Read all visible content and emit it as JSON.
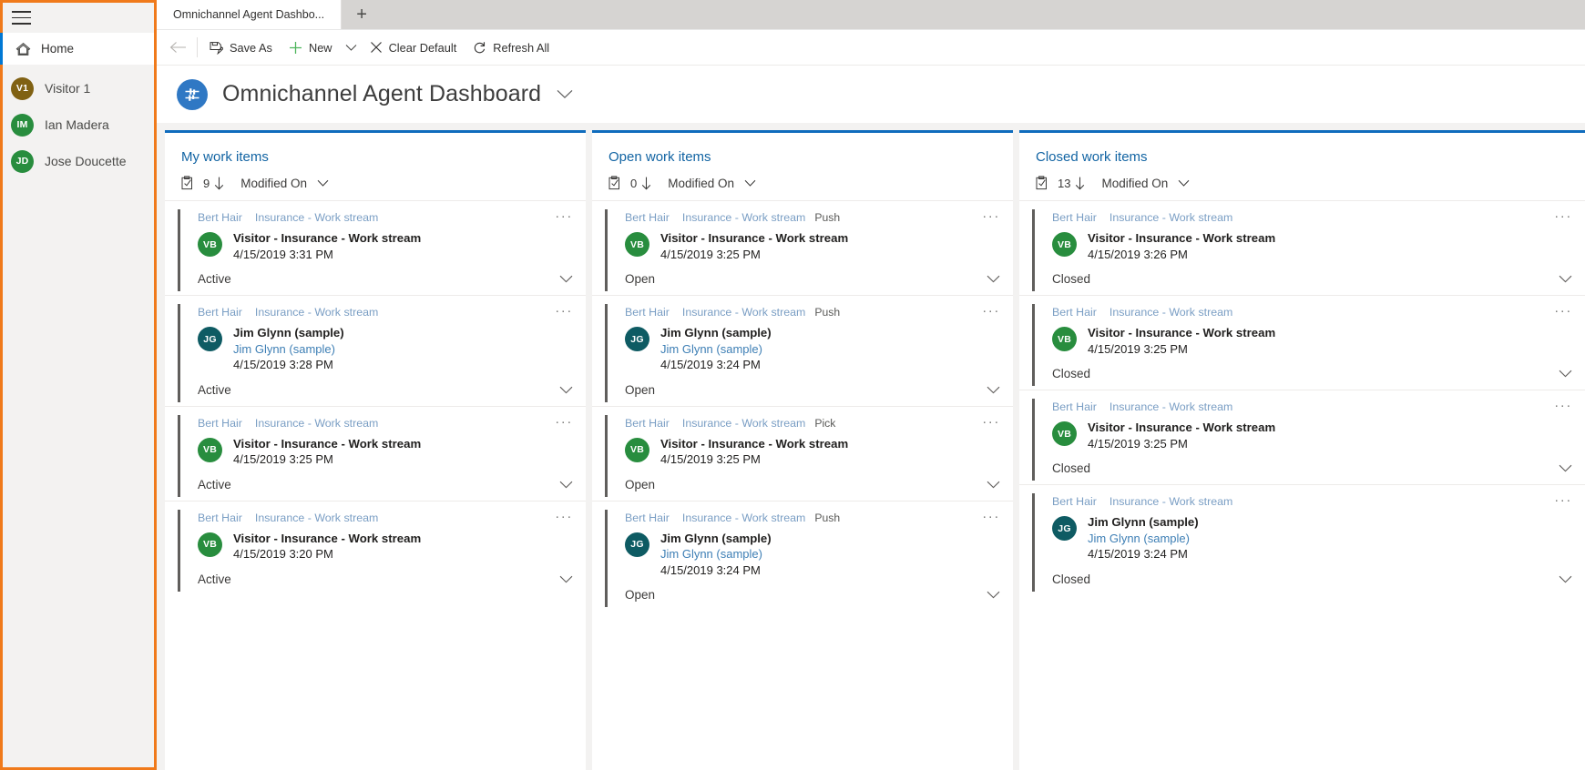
{
  "sidebar": {
    "hamburger_name": "site-map-toggle",
    "home": {
      "label": "Home",
      "icon": "home-icon"
    },
    "people": [
      {
        "initials": "V1",
        "name": "Visitor 1",
        "color": "#806113"
      },
      {
        "initials": "IM",
        "name": "Ian Madera",
        "color": "#288d3e"
      },
      {
        "initials": "JD",
        "name": "Jose Doucette",
        "color": "#288d3e"
      }
    ]
  },
  "tabs": {
    "items": [
      {
        "label": "Omnichannel Agent Dashbo..."
      }
    ],
    "add_label": "+"
  },
  "commandbar": {
    "back_label": "",
    "save_as": "Save As",
    "new": "New",
    "clear_default": "Clear Default",
    "refresh_all": "Refresh All"
  },
  "dashboard": {
    "title": "Omnichannel Agent Dashboard",
    "icon": "dashboard-icon",
    "chevron": "chevron-down-icon"
  },
  "colors": {
    "accent": "#0f6cbd",
    "column_title": "#1264a3",
    "highlight_border": "#f07a1b",
    "avatar_green": "#288d3e",
    "avatar_teal": "#0e5b63",
    "avatar_olive": "#806113"
  },
  "columns": [
    {
      "title": "My work items",
      "count": "9",
      "sort_label": "Modified On",
      "cards": [
        {
          "owner": "Bert Hair",
          "stream": "Insurance - Work stream",
          "mode": "",
          "initials": "VB",
          "avatar_color": "#288d3e",
          "title": "Visitor - Insurance - Work stream",
          "subtitle": "",
          "time": "4/15/2019 3:31 PM",
          "status": "Active"
        },
        {
          "owner": "Bert Hair",
          "stream": "Insurance - Work stream",
          "mode": "",
          "initials": "JG",
          "avatar_color": "#0e5b63",
          "title": "Jim Glynn (sample)",
          "subtitle": "Jim Glynn (sample)",
          "time": "4/15/2019 3:28 PM",
          "status": "Active"
        },
        {
          "owner": "Bert Hair",
          "stream": "Insurance - Work stream",
          "mode": "",
          "initials": "VB",
          "avatar_color": "#288d3e",
          "title": "Visitor - Insurance - Work stream",
          "subtitle": "",
          "time": "4/15/2019 3:25 PM",
          "status": "Active"
        },
        {
          "owner": "Bert Hair",
          "stream": "Insurance - Work stream",
          "mode": "",
          "initials": "VB",
          "avatar_color": "#288d3e",
          "title": "Visitor - Insurance - Work stream",
          "subtitle": "",
          "time": "4/15/2019 3:20 PM",
          "status": "Active"
        }
      ]
    },
    {
      "title": "Open work items",
      "count": "0",
      "sort_label": "Modified On",
      "cards": [
        {
          "owner": "Bert Hair",
          "stream": "Insurance - Work stream",
          "mode": "Push",
          "initials": "VB",
          "avatar_color": "#288d3e",
          "title": "Visitor - Insurance - Work stream",
          "subtitle": "",
          "time": "4/15/2019 3:25 PM",
          "status": "Open"
        },
        {
          "owner": "Bert Hair",
          "stream": "Insurance - Work stream",
          "mode": "Push",
          "initials": "JG",
          "avatar_color": "#0e5b63",
          "title": "Jim Glynn (sample)",
          "subtitle": "Jim Glynn (sample)",
          "time": "4/15/2019 3:24 PM",
          "status": "Open"
        },
        {
          "owner": "Bert Hair",
          "stream": "Insurance - Work stream",
          "mode": "Pick",
          "initials": "VB",
          "avatar_color": "#288d3e",
          "title": "Visitor - Insurance - Work stream",
          "subtitle": "",
          "time": "4/15/2019 3:25 PM",
          "status": "Open"
        },
        {
          "owner": "Bert Hair",
          "stream": "Insurance - Work stream",
          "mode": "Push",
          "initials": "JG",
          "avatar_color": "#0e5b63",
          "title": "Jim Glynn (sample)",
          "subtitle": "Jim Glynn (sample)",
          "time": "4/15/2019 3:24 PM",
          "status": "Open"
        }
      ]
    },
    {
      "title": "Closed work items",
      "count": "13",
      "sort_label": "Modified On",
      "cards": [
        {
          "owner": "Bert Hair",
          "stream": "Insurance - Work stream",
          "mode": "",
          "initials": "VB",
          "avatar_color": "#288d3e",
          "title": "Visitor - Insurance - Work stream",
          "subtitle": "",
          "time": "4/15/2019 3:26 PM",
          "status": "Closed"
        },
        {
          "owner": "Bert Hair",
          "stream": "Insurance - Work stream",
          "mode": "",
          "initials": "VB",
          "avatar_color": "#288d3e",
          "title": "Visitor - Insurance - Work stream",
          "subtitle": "",
          "time": "4/15/2019 3:25 PM",
          "status": "Closed"
        },
        {
          "owner": "Bert Hair",
          "stream": "Insurance - Work stream",
          "mode": "",
          "initials": "VB",
          "avatar_color": "#288d3e",
          "title": "Visitor - Insurance - Work stream",
          "subtitle": "",
          "time": "4/15/2019 3:25 PM",
          "status": "Closed"
        },
        {
          "owner": "Bert Hair",
          "stream": "Insurance - Work stream",
          "mode": "",
          "initials": "JG",
          "avatar_color": "#0e5b63",
          "title": "Jim Glynn (sample)",
          "subtitle": "Jim Glynn (sample)",
          "time": "4/15/2019 3:24 PM",
          "status": "Closed"
        }
      ]
    }
  ],
  "icons": {
    "ellipsis": "···"
  }
}
